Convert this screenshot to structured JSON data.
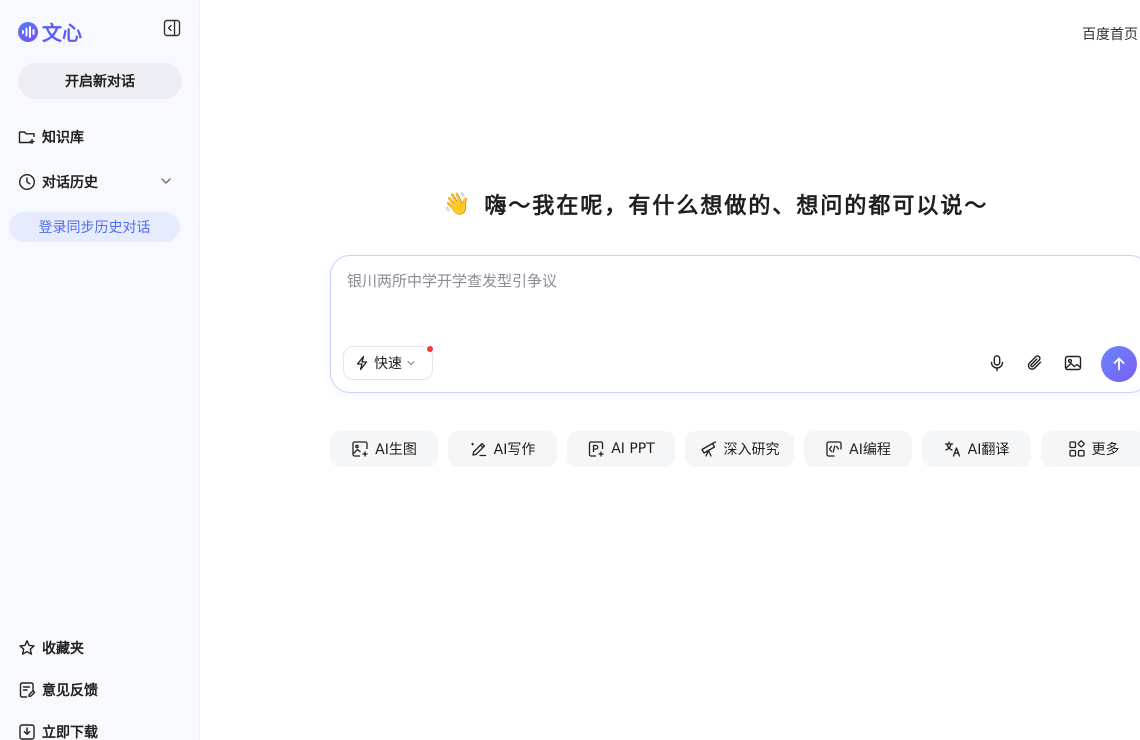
{
  "brand": {
    "name": "文心"
  },
  "sidebar": {
    "new_chat_label": "开启新对话",
    "items": [
      {
        "label": "知识库",
        "icon": "folder-plus-icon"
      },
      {
        "label": "对话历史",
        "icon": "clock-icon"
      }
    ],
    "login_sync_label": "登录同步历史对话",
    "bottom_items": [
      {
        "label": "收藏夹",
        "icon": "star-icon"
      },
      {
        "label": "意见反馈",
        "icon": "feedback-icon"
      },
      {
        "label": "立即下载",
        "icon": "download-icon"
      }
    ]
  },
  "header": {
    "home_link": "百度首页"
  },
  "main": {
    "greeting_emoji": "👋",
    "greeting": "嗨～我在呢，有什么想做的、想问的都可以说～",
    "input_placeholder": "银川两所中学开学查发型引争议",
    "mode_label": "快速",
    "quick_actions": [
      {
        "label": "AI生图",
        "icon": "image-gen-icon"
      },
      {
        "label": "AI写作",
        "icon": "pen-icon"
      },
      {
        "label": "AI PPT",
        "icon": "ppt-icon"
      },
      {
        "label": "深入研究",
        "icon": "telescope-icon"
      },
      {
        "label": "AI编程",
        "icon": "code-icon"
      },
      {
        "label": "AI翻译",
        "icon": "translate-icon"
      },
      {
        "label": "更多",
        "icon": "grid-more-icon"
      }
    ]
  },
  "colors": {
    "accent": "#5a5ff0",
    "sidebar_bg": "#f8f9fe",
    "login_bg": "#e6ebfd",
    "login_text": "#4e6ef2",
    "send_gradient_start": "#6a86ff",
    "send_gradient_end": "#7a5df3",
    "notice_dot": "#f23b3b"
  }
}
